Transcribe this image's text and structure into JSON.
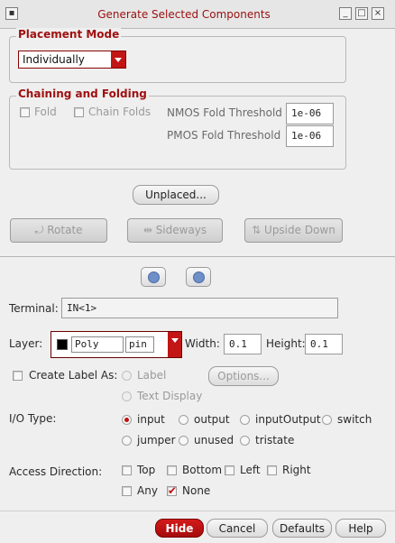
{
  "window": {
    "title": "Generate Selected Components"
  },
  "placement": {
    "group_title": "Placement Mode",
    "mode_value": "Individually"
  },
  "chaining": {
    "group_title": "Chaining and Folding",
    "fold_label": "Fold",
    "chain_label": "Chain Folds",
    "nmos_label": "NMOS Fold Threshold",
    "nmos_value": "1e-06",
    "pmos_label": "PMOS Fold Threshold",
    "pmos_value": "1e-06"
  },
  "buttons": {
    "unplaced": "Unplaced...",
    "rotate": "Rotate",
    "sideways": "Sideways",
    "upside_down": "Upside Down",
    "options": "Options...",
    "hide": "Hide",
    "cancel": "Cancel",
    "defaults": "Defaults",
    "help": "Help"
  },
  "terminal": {
    "label": "Terminal:",
    "value": "IN<1>"
  },
  "layer": {
    "label": "Layer:",
    "name": "Poly",
    "purpose": "pin",
    "width_label": "Width:",
    "width_value": "0.1",
    "height_label": "Height:",
    "height_value": "0.1"
  },
  "label_opts": {
    "create_label": "Create Label As:",
    "label_opt": "Label",
    "text_display": "Text Display"
  },
  "io": {
    "label": "I/O Type:",
    "options": [
      "input",
      "output",
      "inputOutput",
      "switch",
      "jumper",
      "unused",
      "tristate"
    ],
    "selected": "input"
  },
  "access": {
    "label": "Access Direction:",
    "top": "Top",
    "bottom": "Bottom",
    "left": "Left",
    "right": "Right",
    "any": "Any",
    "none": "None"
  },
  "colors": {
    "accent": "#c21515",
    "title_text": "#9a1010"
  }
}
